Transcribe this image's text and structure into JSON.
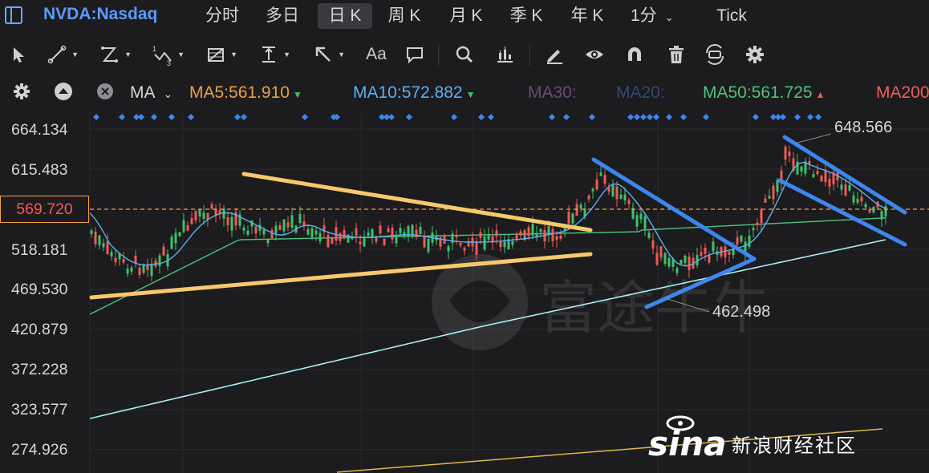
{
  "header": {
    "symbol": "NVDA:Nasdaq",
    "tabs": [
      {
        "label": "分时"
      },
      {
        "label": "多日"
      },
      {
        "label": "日 K",
        "active": true
      },
      {
        "label": "周 K"
      },
      {
        "label": "月 K"
      },
      {
        "label": "季 K"
      },
      {
        "label": "年 K"
      },
      {
        "label": "1分",
        "dropdown": true
      },
      {
        "label": "Tick"
      }
    ]
  },
  "toolbar": {
    "tools": [
      "cursor-icon",
      "line-draw-icon",
      "polyline-icon",
      "wave-icon",
      "fibonacci-icon",
      "vertical-range-icon",
      "arrow-draw-icon",
      "text-icon",
      "note-icon",
      "search-icon",
      "indicator-icon",
      "pencil-icon",
      "eye-icon",
      "magnet-icon",
      "trash-icon",
      "sync-icon",
      "settings-icon"
    ],
    "text_tool_label": "Aa",
    "polyline_sub": "1",
    "wave_sub": "3"
  },
  "indicator_bar": {
    "indicator": "MA",
    "items": [
      {
        "label": "MA5:561.910",
        "color": "#e8a04c",
        "arrow": "▼",
        "arrow_color": "#3ec16b"
      },
      {
        "label": "MA10:572.882",
        "color": "#5bb0f0",
        "arrow": "▼",
        "arrow_color": "#3ec16b"
      },
      {
        "label": "MA30:",
        "color": "#6a4a70"
      },
      {
        "label": "MA20:",
        "color": "#34486e"
      },
      {
        "label": "MA50:561.725",
        "color": "#4ec27e",
        "arrow": "▲",
        "arrow_color": "#f25b55"
      },
      {
        "label": "MA200",
        "color": "#f25b55"
      }
    ]
  },
  "chart": {
    "price_axis": [
      "664.134",
      "615.483",
      "569.720",
      "518.181",
      "469.530",
      "420.879",
      "372.228",
      "323.577",
      "274.926"
    ],
    "current_price": "569.720",
    "annotations": {
      "high": "648.566",
      "low": "462.498"
    },
    "ma_colors": {
      "ma5": "#e8a04c",
      "ma10": "#5bb0f0",
      "ma50": "#4ec27e",
      "ma200": "#a7f0f2"
    },
    "trendline_colors": {
      "yellow": "#f7c96b",
      "blue": "#3d86f0"
    },
    "candle_colors": {
      "up": "#3ec16b",
      "down": "#f25b55"
    }
  },
  "watermark": {
    "brand_text": "富途牛牛",
    "sina_logo": "sina",
    "sina_text": "新浪财经社区"
  }
}
